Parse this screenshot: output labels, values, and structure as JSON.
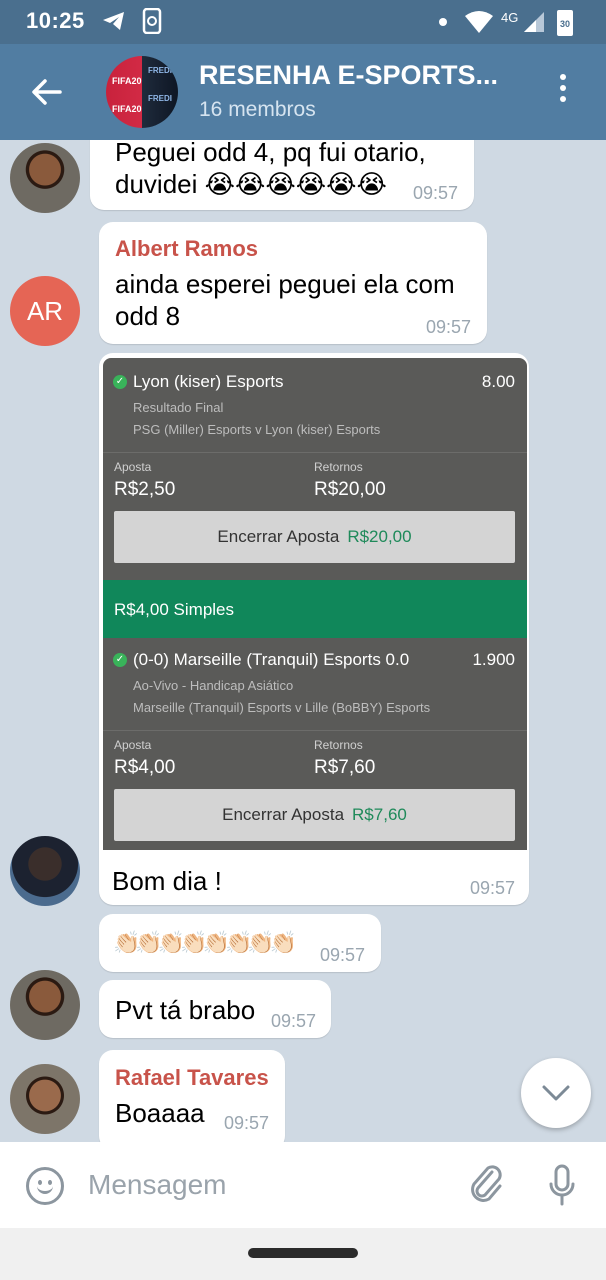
{
  "status_bar": {
    "time": "10:25",
    "network": "4G",
    "battery": "30",
    "icons": [
      "telegram-icon",
      "phone-sync-icon",
      "dot-icon",
      "wifi-icon",
      "signal-icon",
      "battery-icon"
    ]
  },
  "header": {
    "title": "RESENHA E-SPORTS...",
    "subtitle": "16 membros",
    "avatar_text_left": "FIFA20",
    "avatar_text_right": "FREDI"
  },
  "messages": [
    {
      "id": "m1",
      "lines": [
        "Peguei odd 4, pq fui otario,",
        "duvidei 😭😭😭😭😭😭"
      ],
      "time": "09:57"
    },
    {
      "id": "m2",
      "sender": "Albert Ramos",
      "avatar_initials": "AR",
      "lines": [
        "ainda esperei peguei ela com",
        "odd 8"
      ],
      "time": "09:57"
    },
    {
      "id": "m3",
      "caption": "Bom dia !",
      "time": "09:57"
    },
    {
      "id": "m4",
      "text": "👏🏻👏🏻👏🏻👏🏻👏🏻👏🏻👏🏻👏🏻",
      "time": "09:57"
    },
    {
      "id": "m5",
      "text": "Pvt tá brabo",
      "time": "09:57"
    },
    {
      "id": "m6",
      "sender": "Rafael Tavares",
      "text": "Boaaaa",
      "time": "09:57"
    }
  ],
  "bet_slip": {
    "bet1": {
      "selection": "Lyon (kiser) Esports",
      "odd": "8.00",
      "market": "Resultado Final",
      "match": "PSG (Miller) Esports v Lyon (kiser) Esports",
      "stake_label": "Aposta",
      "stake": "R$2,50",
      "return_label": "Retornos",
      "return": "R$20,00",
      "cashout_label": "Encerrar Aposta",
      "cashout_value": "R$20,00"
    },
    "header2": "R$4,00 Simples",
    "bet2": {
      "selection": "(0-0) Marseille (Tranquil) Esports 0.0",
      "odd": "1.900",
      "market": "Ao-Vivo - Handicap Asiático",
      "match": "Marseille (Tranquil) Esports v Lille (BoBBY) Esports",
      "stake_label": "Aposta",
      "stake": "R$4,00",
      "return_label": "Retornos",
      "return": "R$7,60",
      "cashout_label": "Encerrar Aposta",
      "cashout_value": "R$7,60"
    }
  },
  "input": {
    "placeholder": "Mensagem"
  },
  "colors": {
    "header": "#517da2",
    "status_bar": "#4a6f8e",
    "chat_bg": "#cfd9e3",
    "sender_name": "#c8534a",
    "bet_green": "#10875a",
    "slip_bg": "#5a5a58"
  }
}
